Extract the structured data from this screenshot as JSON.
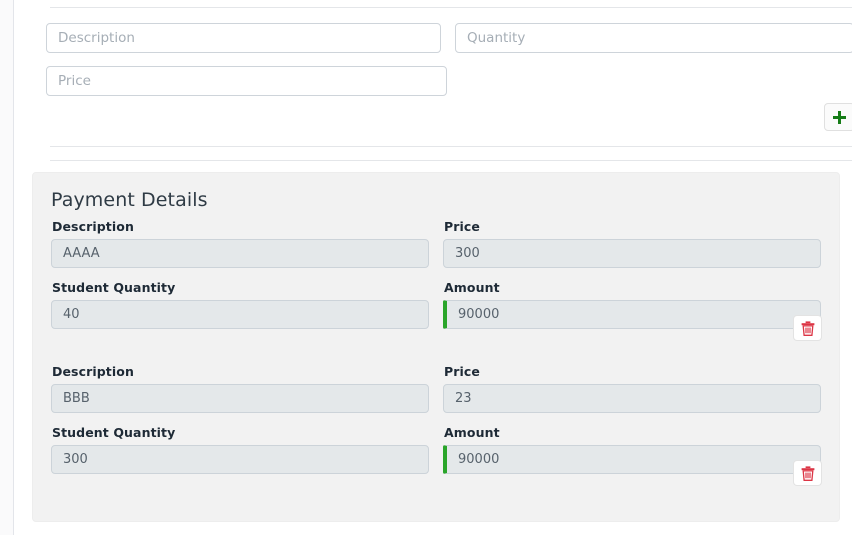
{
  "colors": {
    "page_bg": "#ffffff",
    "panel_bg": "#f2f2f2",
    "input_bg": "#e4e8ea",
    "accent_green": "#2aa52a",
    "add_green": "#167c17",
    "delete_red": "#dc3545",
    "divider": "#e4e6e9",
    "label_text": "#1e2a36"
  },
  "entry_form": {
    "fields": [
      {
        "name": "description",
        "placeholder": "Description",
        "value": ""
      },
      {
        "name": "quantity",
        "placeholder": "Quantity",
        "value": ""
      },
      {
        "name": "price",
        "placeholder": "Price",
        "value": ""
      }
    ],
    "add_button": {
      "icon": "plus-icon",
      "label": "+"
    }
  },
  "payment_details": {
    "title": "Payment Details",
    "labels": {
      "description": "Description",
      "price": "Price",
      "student_quantity": "Student Quantity",
      "amount": "Amount"
    },
    "delete_button": {
      "icon": "trash-icon"
    },
    "rows": [
      {
        "description": "AAAA",
        "price": "300",
        "student_quantity": "40",
        "amount": "90000"
      },
      {
        "description": "BBB",
        "price": "23",
        "student_quantity": "300",
        "amount": "90000"
      }
    ]
  }
}
